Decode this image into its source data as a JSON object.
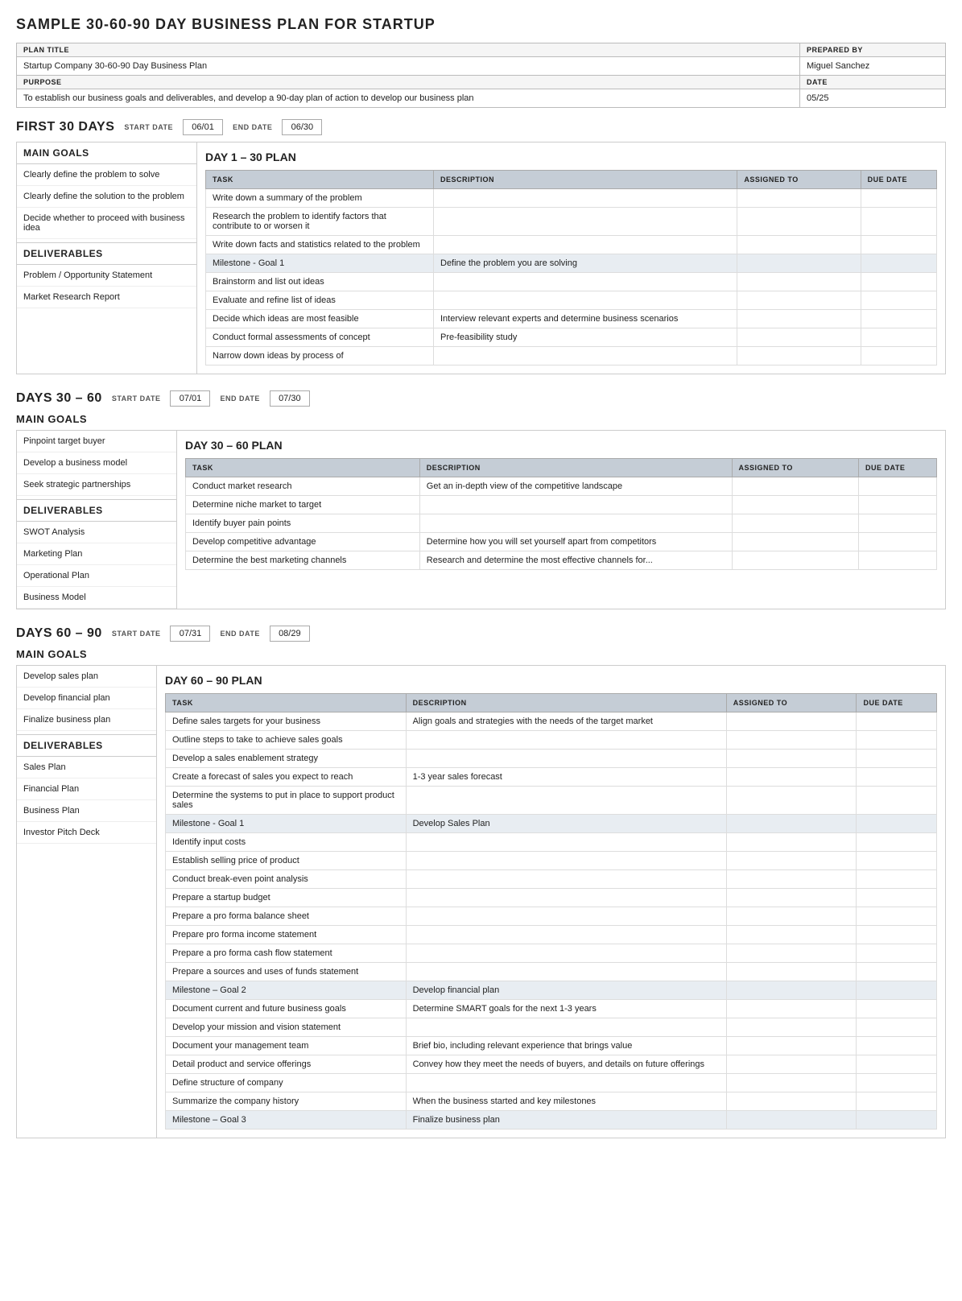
{
  "page": {
    "title": "SAMPLE 30-60-90 DAY BUSINESS PLAN FOR STARTUP",
    "meta": {
      "plan_title_label": "PLAN TITLE",
      "plan_title_value": "Startup Company 30-60-90 Day Business Plan",
      "prepared_by_label": "PREPARED BY",
      "prepared_by_value": "Miguel Sanchez",
      "purpose_label": "PURPOSE",
      "purpose_value": "To establish our business goals and deliverables, and develop a 90-day plan of action to develop our business plan",
      "date_label": "DATE",
      "date_value": "05/25"
    },
    "first30": {
      "title": "FIRST 30 DAYS",
      "start_date_label": "START DATE",
      "start_date": "06/01",
      "end_date_label": "END DATE",
      "end_date": "06/30",
      "main_goals_label": "MAIN GOALS",
      "goals": [
        "Clearly define the problem to solve",
        "Clearly define the solution to the problem",
        "Decide whether to proceed with business idea"
      ],
      "deliverables_label": "DELIVERABLES",
      "deliverables": [
        "Problem / Opportunity Statement",
        "Market Research Report"
      ],
      "plan_title": "DAY 1 – 30 PLAN",
      "plan_columns": [
        "TASK",
        "DESCRIPTION",
        "ASSIGNED TO",
        "DUE DATE"
      ],
      "plan_rows": [
        {
          "task": "Write down a summary of the problem",
          "description": "",
          "assigned": "",
          "due": ""
        },
        {
          "task": "Research the problem to identify factors that contribute to or worsen it",
          "description": "",
          "assigned": "",
          "due": ""
        },
        {
          "task": "Write down facts and statistics related to the problem",
          "description": "",
          "assigned": "",
          "due": ""
        },
        {
          "task": "Milestone - Goal 1",
          "description": "Define the problem you are solving",
          "assigned": "",
          "due": "",
          "milestone": true
        },
        {
          "task": "Brainstorm and list out ideas",
          "description": "",
          "assigned": "",
          "due": ""
        },
        {
          "task": "Evaluate and refine list of ideas",
          "description": "",
          "assigned": "",
          "due": ""
        },
        {
          "task": "Decide which ideas are most feasible",
          "description": "Interview relevant experts and determine business scenarios",
          "assigned": "",
          "due": ""
        },
        {
          "task": "Conduct formal assessments of concept",
          "description": "Pre-feasibility study",
          "assigned": "",
          "due": ""
        },
        {
          "task": "Narrow down ideas by process of",
          "description": "",
          "assigned": "",
          "due": ""
        }
      ]
    },
    "days3060": {
      "title": "DAYS 30 – 60",
      "start_date_label": "START DATE",
      "start_date": "07/01",
      "end_date_label": "END DATE",
      "end_date": "07/30",
      "main_goals_label": "MAIN GOALS",
      "goals": [
        "Pinpoint target buyer",
        "Develop a business model",
        "Seek strategic partnerships"
      ],
      "deliverables_label": "DELIVERABLES",
      "deliverables": [
        "SWOT Analysis",
        "Marketing Plan",
        "Operational Plan",
        "Business Model"
      ],
      "plan_title": "DAY 30 – 60 PLAN",
      "plan_columns": [
        "TASK",
        "DESCRIPTION",
        "ASSIGNED TO",
        "DUE DATE"
      ],
      "plan_rows": [
        {
          "task": "Conduct market research",
          "description": "Get an in-depth view of the competitive landscape",
          "assigned": "",
          "due": ""
        },
        {
          "task": "Determine niche market to target",
          "description": "",
          "assigned": "",
          "due": ""
        },
        {
          "task": "Identify buyer pain points",
          "description": "",
          "assigned": "",
          "due": ""
        },
        {
          "task": "Develop competitive advantage",
          "description": "Determine how you will set yourself apart from competitors",
          "assigned": "",
          "due": ""
        },
        {
          "task": "Determine the best marketing channels",
          "description": "Research and determine the most effective channels for...",
          "assigned": "",
          "due": ""
        }
      ]
    },
    "days6090": {
      "title": "DAYS 60 – 90",
      "start_date_label": "START DATE",
      "start_date": "07/31",
      "end_date_label": "END DATE",
      "end_date": "08/29",
      "main_goals_label": "MAIN GOALS",
      "goals": [
        "Develop sales plan",
        "Develop financial plan",
        "Finalize business plan"
      ],
      "deliverables_label": "DELIVERABLES",
      "deliverables": [
        "Sales Plan",
        "Financial Plan",
        "Business Plan",
        "Investor Pitch Deck"
      ],
      "plan_title": "DAY 60 – 90 PLAN",
      "plan_columns": [
        "TASK",
        "DESCRIPTION",
        "ASSIGNED TO",
        "DUE DATE"
      ],
      "plan_rows": [
        {
          "task": "Define sales targets for your business",
          "description": "Align goals and strategies with the needs of the target market",
          "assigned": "",
          "due": ""
        },
        {
          "task": "Outline steps to take to achieve sales goals",
          "description": "",
          "assigned": "",
          "due": ""
        },
        {
          "task": "Develop a sales enablement strategy",
          "description": "",
          "assigned": "",
          "due": ""
        },
        {
          "task": "Create a forecast of sales you expect to reach",
          "description": "1-3 year sales forecast",
          "assigned": "",
          "due": ""
        },
        {
          "task": "Determine the systems to put in place to support product sales",
          "description": "",
          "assigned": "",
          "due": ""
        },
        {
          "task": "Milestone - Goal 1",
          "description": "Develop Sales Plan",
          "assigned": "",
          "due": "",
          "milestone": true
        },
        {
          "task": "Identify input costs",
          "description": "",
          "assigned": "",
          "due": ""
        },
        {
          "task": "Establish selling price of product",
          "description": "",
          "assigned": "",
          "due": ""
        },
        {
          "task": "Conduct break-even point analysis",
          "description": "",
          "assigned": "",
          "due": ""
        },
        {
          "task": "Prepare a startup budget",
          "description": "",
          "assigned": "",
          "due": ""
        },
        {
          "task": "Prepare a pro forma balance sheet",
          "description": "",
          "assigned": "",
          "due": ""
        },
        {
          "task": "Prepare pro forma income statement",
          "description": "",
          "assigned": "",
          "due": ""
        },
        {
          "task": "Prepare a pro forma cash flow statement",
          "description": "",
          "assigned": "",
          "due": ""
        },
        {
          "task": "Prepare a sources and uses of funds statement",
          "description": "",
          "assigned": "",
          "due": ""
        },
        {
          "task": "Milestone – Goal 2",
          "description": "Develop financial plan",
          "assigned": "",
          "due": "",
          "milestone": true
        },
        {
          "task": "Document current and future business goals",
          "description": "Determine SMART goals for the next 1-3 years",
          "assigned": "",
          "due": ""
        },
        {
          "task": "Develop your mission and vision statement",
          "description": "",
          "assigned": "",
          "due": ""
        },
        {
          "task": "Document your management team",
          "description": "Brief bio, including relevant experience that brings value",
          "assigned": "",
          "due": ""
        },
        {
          "task": "Detail product and service offerings",
          "description": "Convey how they meet the needs of buyers, and details on future offerings",
          "assigned": "",
          "due": ""
        },
        {
          "task": "Define structure of company",
          "description": "",
          "assigned": "",
          "due": ""
        },
        {
          "task": "Summarize the company history",
          "description": "When the business started and key milestones",
          "assigned": "",
          "due": ""
        },
        {
          "task": "Milestone – Goal 3",
          "description": "Finalize business plan",
          "assigned": "",
          "due": "",
          "milestone": true
        }
      ]
    }
  }
}
